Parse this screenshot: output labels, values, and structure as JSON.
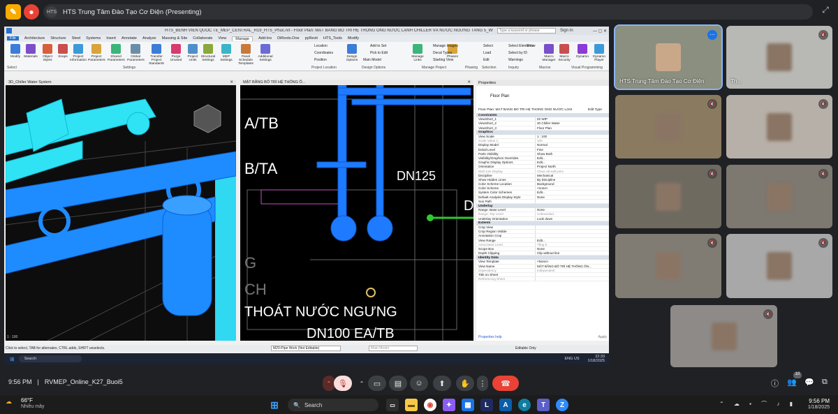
{
  "meet_top": {
    "presenting_title": "HTS Trung Tâm Đào Tạo Cơ Điện (Presenting)"
  },
  "revit": {
    "window_title": "HTS_BENH VIEN QUOC TE_MEP_CENTRAL_R19_HTS_Phuc.rvt - Floor Plan: MẶT BẰNG BỐ TRÍ HỆ THỐNG ỐNG NƯỚC LẠNH CHILLER VÀ NƯỚC NGƯNG TẦNG 5_WIP",
    "search_placeholder": "Type a keyword or phrase",
    "sign_in": "Sign In",
    "tabs": [
      "File",
      "Architecture",
      "Structure",
      "Steel",
      "Systems",
      "Insert",
      "Annotate",
      "Analyze",
      "Massing & Site",
      "Collaborate",
      "View",
      "Manage",
      "Add-Ins",
      "DiRoots.One",
      "pyRevit",
      "HTS_Tools",
      "Modify"
    ],
    "active_tab": "Manage",
    "ribbon_buttons": [
      "Modify",
      "Materials",
      "Object Styles",
      "Snaps",
      "Project Information",
      "Project Parameters",
      "Shared Parameters",
      "Global Parameters",
      "Transfer Project Standards",
      "Purge Unused",
      "Project Units",
      "Structural Settings",
      "MEP Settings",
      "Panel Schedule Templates",
      "Additional Settings",
      "Design Options",
      "Manage Links",
      "Phases",
      "Macro Manager",
      "Macro Security",
      "Dynamo",
      "Dynamo Player"
    ],
    "ribbon_small": [
      "Location",
      "Coordinates",
      "Position",
      "Add to Set",
      "Pick to Edit",
      "Main Model",
      "Manage Images",
      "Decal Types",
      "Starting View",
      "Select",
      "Load",
      "Edit",
      "Select by ID",
      "Warnings",
      "Show",
      "Select Elements"
    ],
    "ribbon_groups": [
      "Select",
      "Settings",
      "Project Location",
      "Design Options",
      "Manage Project",
      "Phasing",
      "Selection",
      "Inquiry",
      "Macros",
      "Visual Programming"
    ],
    "view3d_title": "3D_Chiller Water System",
    "plan_title": "MẶT BẰNG BỐ TRÍ HỆ THỐNG Ố...",
    "plan_texts": [
      "A/TB",
      "B/TA",
      "DN125",
      "G",
      "CH",
      "THOÁT NƯỚC NGƯNG",
      "DN100 EA/TB",
      "D"
    ],
    "scale_left": "1 : 100",
    "scale_plan": "1 : 100",
    "properties": {
      "header": "Properties",
      "type": "Floor Plan",
      "selector": "Floor Plan: MẶT BẰNG BỐ TRÍ HỆ THỐNG ỐNG NƯỚC LẠNI",
      "edit_type": "Edit Type",
      "sections": [
        {
          "name": "Constraints",
          "rows": [
            [
              "ViewShort_1",
              "02 WIP"
            ],
            [
              "ViewShort_2",
              "20 Chiller Water"
            ],
            [
              "ViewShort_3",
              "Floor Plan"
            ]
          ]
        },
        {
          "name": "Graphics",
          "rows": [
            [
              "View Scale",
              "1 : 100"
            ],
            [
              "Scale Value  1:",
              "100"
            ],
            [
              "Display Model",
              "Normal"
            ],
            [
              "Detail Level",
              "Fine"
            ],
            [
              "Parts Visibility",
              "Show Both"
            ],
            [
              "Visibility/Graphics Overrides",
              "Edit..."
            ],
            [
              "Graphic Display Options",
              "Edit..."
            ],
            [
              "Orientation",
              "Project North"
            ],
            [
              "Wall Join Display",
              "Clean all wall joins"
            ],
            [
              "Discipline",
              "Mechanical"
            ],
            [
              "Show Hidden Lines",
              "By Discipline"
            ],
            [
              "Color Scheme Location",
              "Background"
            ],
            [
              "Color Scheme",
              "<none>"
            ],
            [
              "System Color Schemes",
              "Edit..."
            ],
            [
              "Default Analysis Display Style",
              "None"
            ],
            [
              "Sun Path",
              ""
            ]
          ]
        },
        {
          "name": "Underlay",
          "rows": [
            [
              "Range: Base Level",
              "None"
            ],
            [
              "Range: Top Level",
              "Unbounded"
            ],
            [
              "Underlay Orientation",
              "Look down"
            ]
          ]
        },
        {
          "name": "Extents",
          "rows": [
            [
              "Crop View",
              ""
            ],
            [
              "Crop Region Visible",
              ""
            ],
            [
              "Annotation Crop",
              ""
            ],
            [
              "View Range",
              "Edit..."
            ],
            [
              "Associated Level",
              "Tầng 5"
            ],
            [
              "Scope Box",
              "None"
            ],
            [
              "Depth Clipping",
              "Clip without line"
            ]
          ]
        },
        {
          "name": "Identity Data",
          "rows": [
            [
              "View Template",
              "<None>"
            ],
            [
              "View Name",
              "MẶT BẰNG BỐ TRÍ HỆ THỐNG ỐN..."
            ],
            [
              "Dependency",
              "Independent"
            ],
            [
              "Title on Sheet",
              ""
            ],
            [
              "Referencing Sheet",
              ""
            ]
          ]
        }
      ],
      "help": "Properties help",
      "apply": "Apply"
    },
    "status_text": "Click to select, TAB for alternates, CTRL adds, SHIFT unselects.",
    "status_workset": "M20-Pipe Work (Not Editable)",
    "status_model": "Main Model",
    "status_editable": "Editable Only",
    "inner_search": "Search",
    "inner_lang": "ENG US",
    "inner_time": "22:33",
    "inner_date": "1/18/2025"
  },
  "participants": [
    {
      "name": "HTS Trung Tâm Đào Tạo Cơ Điện",
      "active": true
    },
    {
      "name": "Th..."
    },
    {
      "name": ""
    },
    {
      "name": ""
    },
    {
      "name": ""
    },
    {
      "name": ""
    },
    {
      "name": ""
    },
    {
      "name": ""
    },
    {
      "name": ""
    }
  ],
  "meeting": {
    "time": "9:56 PM",
    "separator": "|",
    "code": "RVMEP_Online_K27_Buoi5",
    "people_count": "10"
  },
  "taskbar": {
    "temp": "66°F",
    "weather": "Nhiều mây",
    "search": "Search",
    "time": "9:56 PM",
    "date": "1/18/2025"
  },
  "colors": {
    "pipe_cyan": "#19d5f5",
    "pipe_blue": "#1e7bff",
    "end_call": "#ea4335",
    "mic_off": "#f28b82"
  }
}
